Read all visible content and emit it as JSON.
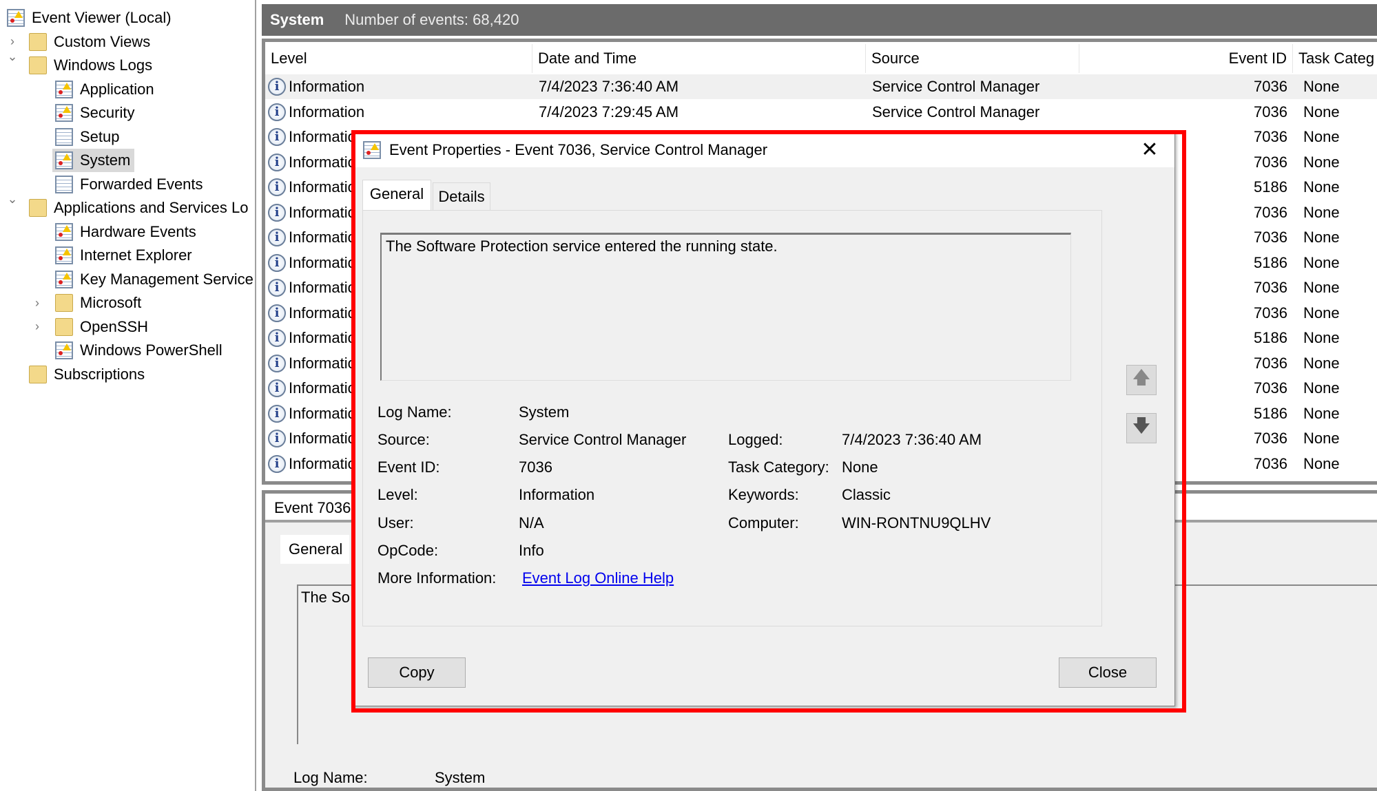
{
  "tree": {
    "items": [
      {
        "label": "Event Viewer (Local)",
        "depth": 0,
        "icon": "event-viewer-icon",
        "chevron": ""
      },
      {
        "label": "Custom Views",
        "depth": 1,
        "icon": "folder-filter-icon",
        "chevron": "collapsed"
      },
      {
        "label": "Windows Logs",
        "depth": 1,
        "icon": "folder-logs-icon",
        "chevron": "expanded"
      },
      {
        "label": "Application",
        "depth": 2,
        "icon": "log-alert-icon",
        "chevron": ""
      },
      {
        "label": "Security",
        "depth": 2,
        "icon": "log-alert-icon",
        "chevron": ""
      },
      {
        "label": "Setup",
        "depth": 2,
        "icon": "log-icon",
        "chevron": ""
      },
      {
        "label": "System",
        "depth": 2,
        "icon": "log-alert-icon",
        "chevron": "",
        "selected": true
      },
      {
        "label": "Forwarded Events",
        "depth": 2,
        "icon": "log-icon",
        "chevron": ""
      },
      {
        "label": "Applications and Services Lo",
        "depth": 1,
        "icon": "folder-icon",
        "chevron": "expanded"
      },
      {
        "label": "Hardware Events",
        "depth": 2,
        "icon": "log-alert-icon",
        "chevron": ""
      },
      {
        "label": "Internet Explorer",
        "depth": 2,
        "icon": "log-alert-icon",
        "chevron": ""
      },
      {
        "label": "Key Management Service",
        "depth": 2,
        "icon": "log-alert-icon",
        "chevron": ""
      },
      {
        "label": "Microsoft",
        "depth": 2,
        "icon": "folder-icon",
        "chevron": "collapsed"
      },
      {
        "label": "OpenSSH",
        "depth": 2,
        "icon": "folder-icon",
        "chevron": "collapsed"
      },
      {
        "label": "Windows PowerShell",
        "depth": 2,
        "icon": "log-alert-icon",
        "chevron": ""
      },
      {
        "label": "Subscriptions",
        "depth": 1,
        "icon": "subscriptions-icon",
        "chevron": ""
      }
    ]
  },
  "header": {
    "title": "System",
    "count": "Number of events: 68,420"
  },
  "table": {
    "columns": [
      "Level",
      "Date and Time",
      "Source",
      "Event ID",
      "Task Categ"
    ],
    "rows": [
      {
        "level": "Information",
        "date": "7/4/2023 7:36:40 AM",
        "source": "Service Control Manager",
        "id": "7036",
        "task": "None"
      },
      {
        "level": "Information",
        "date": "7/4/2023 7:29:45 AM",
        "source": "Service Control Manager",
        "id": "7036",
        "task": "None"
      },
      {
        "level": "Information",
        "id": "7036",
        "task": "None"
      },
      {
        "level": "Information",
        "id": "7036",
        "task": "None"
      },
      {
        "level": "Information",
        "id": "5186",
        "task": "None"
      },
      {
        "level": "Information",
        "id": "7036",
        "task": "None"
      },
      {
        "level": "Information",
        "id": "7036",
        "task": "None"
      },
      {
        "level": "Information",
        "id": "5186",
        "task": "None"
      },
      {
        "level": "Information",
        "id": "7036",
        "task": "None"
      },
      {
        "level": "Information",
        "id": "7036",
        "task": "None"
      },
      {
        "level": "Information",
        "id": "5186",
        "task": "None"
      },
      {
        "level": "Information",
        "id": "7036",
        "task": "None"
      },
      {
        "level": "Information",
        "id": "7036",
        "task": "None"
      },
      {
        "level": "Information",
        "id": "5186",
        "task": "None"
      },
      {
        "level": "Information",
        "id": "7036",
        "task": "None"
      },
      {
        "level": "Information",
        "id": "7036",
        "task": "None"
      }
    ]
  },
  "lower": {
    "title": "Event 7036",
    "tab": "General",
    "text": "The So",
    "log_name_label": "Log Name:",
    "log_name_value": "System"
  },
  "dialog": {
    "title": "Event Properties - Event 7036, Service Control Manager",
    "tabs": [
      "General",
      "Details"
    ],
    "description": "The Software Protection service entered the running state.",
    "fields": {
      "log_name": {
        "label": "Log Name:",
        "value": "System"
      },
      "source": {
        "label": "Source:",
        "value": "Service Control Manager"
      },
      "logged": {
        "label": "Logged:",
        "value": "7/4/2023 7:36:40 AM"
      },
      "event_id": {
        "label": "Event ID:",
        "value": "7036"
      },
      "task_category": {
        "label": "Task Category:",
        "value": "None"
      },
      "level": {
        "label": "Level:",
        "value": "Information"
      },
      "keywords": {
        "label": "Keywords:",
        "value": "Classic"
      },
      "user": {
        "label": "User:",
        "value": "N/A"
      },
      "computer": {
        "label": "Computer:",
        "value": "WIN-RONTNU9QLHV"
      },
      "opcode": {
        "label": "OpCode:",
        "value": "Info"
      },
      "more_info": {
        "label": "More Information:",
        "value": "Event Log Online Help"
      }
    },
    "copy_label": "Copy",
    "close_label": "Close",
    "close_glyph": "✕",
    "up_glyph": "🡅",
    "down_glyph": "🡇"
  },
  "colors": {
    "highlight": "#ff0000",
    "link": "#0000ee",
    "header_bar": "#6b6b6b"
  }
}
